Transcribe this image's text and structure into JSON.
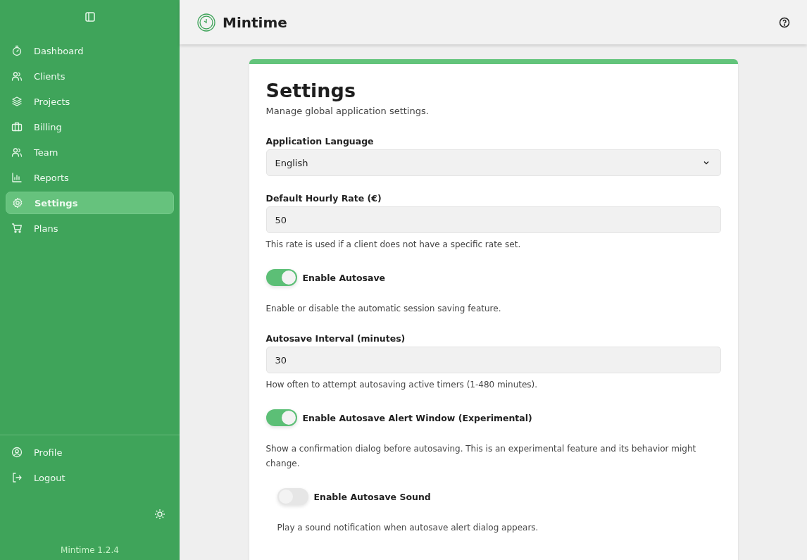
{
  "sidebar": {
    "items": [
      {
        "label": "Dashboard",
        "selected": false
      },
      {
        "label": "Clients",
        "selected": false
      },
      {
        "label": "Projects",
        "selected": false
      },
      {
        "label": "Billing",
        "selected": false
      },
      {
        "label": "Team",
        "selected": false
      },
      {
        "label": "Reports",
        "selected": false
      },
      {
        "label": "Settings",
        "selected": true
      },
      {
        "label": "Plans",
        "selected": false
      }
    ],
    "bottom_items": [
      {
        "label": "Profile"
      },
      {
        "label": "Logout"
      }
    ],
    "version": "Mintime 1.2.4"
  },
  "header": {
    "title": "Mintime"
  },
  "settings": {
    "title": "Settings",
    "subtitle": "Manage global application settings.",
    "fields": [
      {
        "kind": "select",
        "label": "Application Language",
        "value": "English"
      },
      {
        "kind": "input",
        "label": "Default Hourly Rate (€)",
        "value": "50",
        "help": "This rate is used if a client does not have a specific rate set."
      },
      {
        "kind": "toggle",
        "label": "Enable Autosave",
        "on": true,
        "help": "Enable or disable the automatic session saving feature."
      },
      {
        "kind": "input",
        "label": "Autosave Interval (minutes)",
        "value": "30",
        "help": "How often to attempt autosaving active timers (1-480 minutes)."
      },
      {
        "kind": "toggle",
        "label": "Enable Autosave Alert Window (Experimental)",
        "on": true,
        "help": "Show a confirmation dialog before autosaving. This is an experimental feature and its behavior might change."
      },
      {
        "kind": "subtoggle",
        "label": "Enable Autosave Sound",
        "on": false,
        "help": "Play a sound notification when autosave alert dialog appears."
      }
    ]
  }
}
